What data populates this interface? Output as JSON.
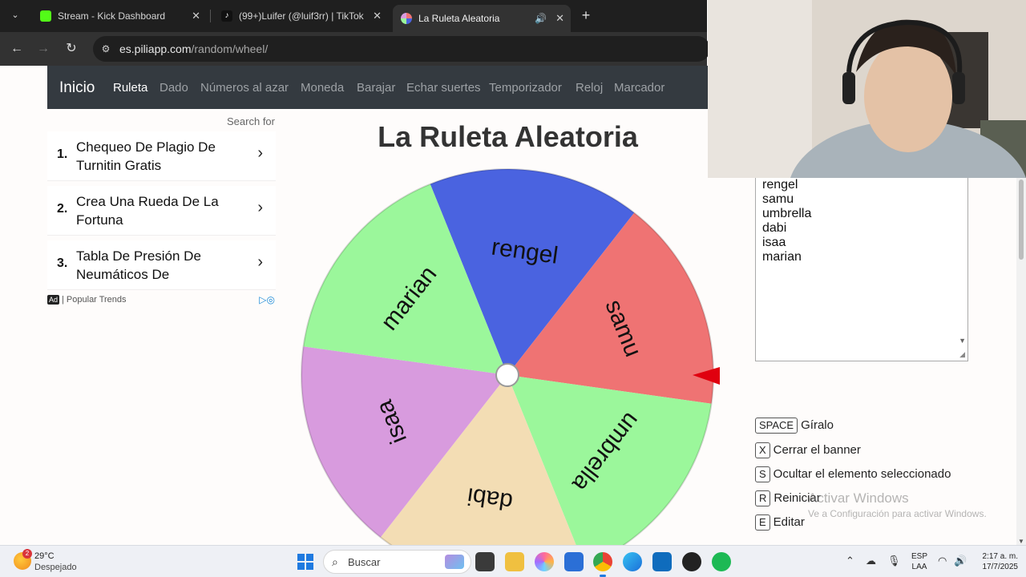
{
  "browser": {
    "tabs": [
      {
        "label": "Stream - Kick Dashboard",
        "favicon": "kick-icon",
        "color": "#53fc18"
      },
      {
        "label": "(99+)Luifer (@luif3rr) | TikTok",
        "favicon": "tiktok-icon",
        "color": "#111111"
      },
      {
        "label": "La Ruleta Aleatoria",
        "favicon": "wheel-icon",
        "color": "#c55ec3",
        "active": true
      }
    ],
    "url_host": "es.piliapp.com",
    "url_path": "/random/wheel/"
  },
  "site": {
    "brand": "Inicio",
    "nav": [
      "Ruleta",
      "Dado",
      "Números al azar",
      "Moneda",
      "Barajar",
      "Echar suertes",
      "Temporizador",
      "Reloj",
      "Marcador"
    ],
    "active_nav": "Ruleta",
    "title": "La Ruleta Aleatoria"
  },
  "ads": {
    "search_for": "Search for",
    "items": [
      {
        "num": "1.",
        "text": "Chequeo De Plagio De Turnitin Gratis"
      },
      {
        "num": "2.",
        "text": "Crea Una Rueda De La Fortuna"
      },
      {
        "num": "3.",
        "text": "Tabla De Presión De Neumáticos De"
      }
    ],
    "badge": "Ad",
    "footer": "| Popular Trends"
  },
  "wheel": {
    "segments": [
      {
        "label": "rengel",
        "color": "#4a63e0"
      },
      {
        "label": "samu",
        "color": "#ef7373"
      },
      {
        "label": "umbrella",
        "color": "#9bf79b"
      },
      {
        "label": "dabi",
        "color": "#f3ddb4"
      },
      {
        "label": "isaa",
        "color": "#d89bde"
      },
      {
        "label": "marian",
        "color": "#9bf79b"
      }
    ],
    "pointer_color": "#e0000f"
  },
  "entries": [
    "rengel",
    "samu",
    "umbrella",
    "dabi",
    "isaa",
    "marian"
  ],
  "shortcuts": [
    {
      "key": "SPACE",
      "label": "Gíralo"
    },
    {
      "key": "X",
      "label": "Cerrar el banner"
    },
    {
      "key": "S",
      "label": "Ocultar el elemento seleccionado"
    },
    {
      "key": "R",
      "label": "Reiniciar"
    },
    {
      "key": "E",
      "label": "Editar"
    }
  ],
  "watermark": {
    "title": "Activar Windows",
    "subtitle": "Ve a Configuración para activar Windows."
  },
  "taskbar": {
    "weather_badge": "2",
    "temperature": "29°C",
    "condition": "Despejado",
    "search": "Buscar",
    "lang_top": "ESP",
    "lang_bottom": "LAA",
    "time": "2:17 a. m.",
    "date": "17/7/2025"
  }
}
